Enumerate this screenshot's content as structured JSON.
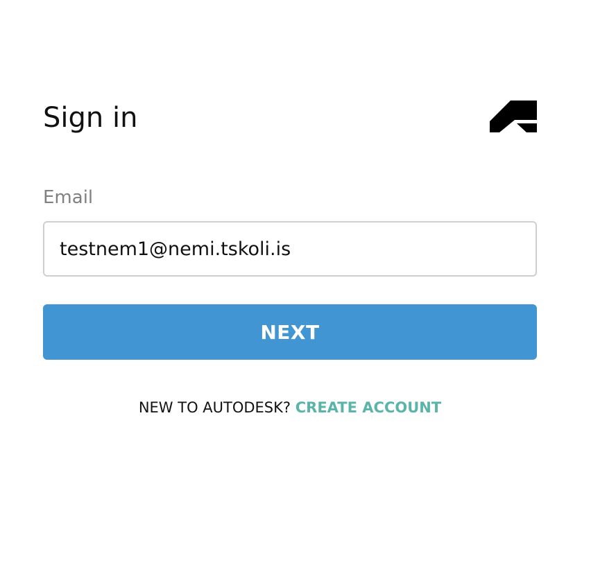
{
  "form": {
    "title": "Sign in",
    "brand_logo_icon": "autodesk-logo-icon",
    "email_label": "Email",
    "email_value": "testnem1@nemi.tskoli.is",
    "next_label": "NEXT"
  },
  "signup": {
    "prompt": "NEW TO AUTODESK?",
    "link_label": "CREATE ACCOUNT"
  },
  "colors": {
    "primary_button": "#4195d3",
    "link": "#5ab5a8",
    "label": "#808080",
    "input_border": "#cfcfcf"
  }
}
